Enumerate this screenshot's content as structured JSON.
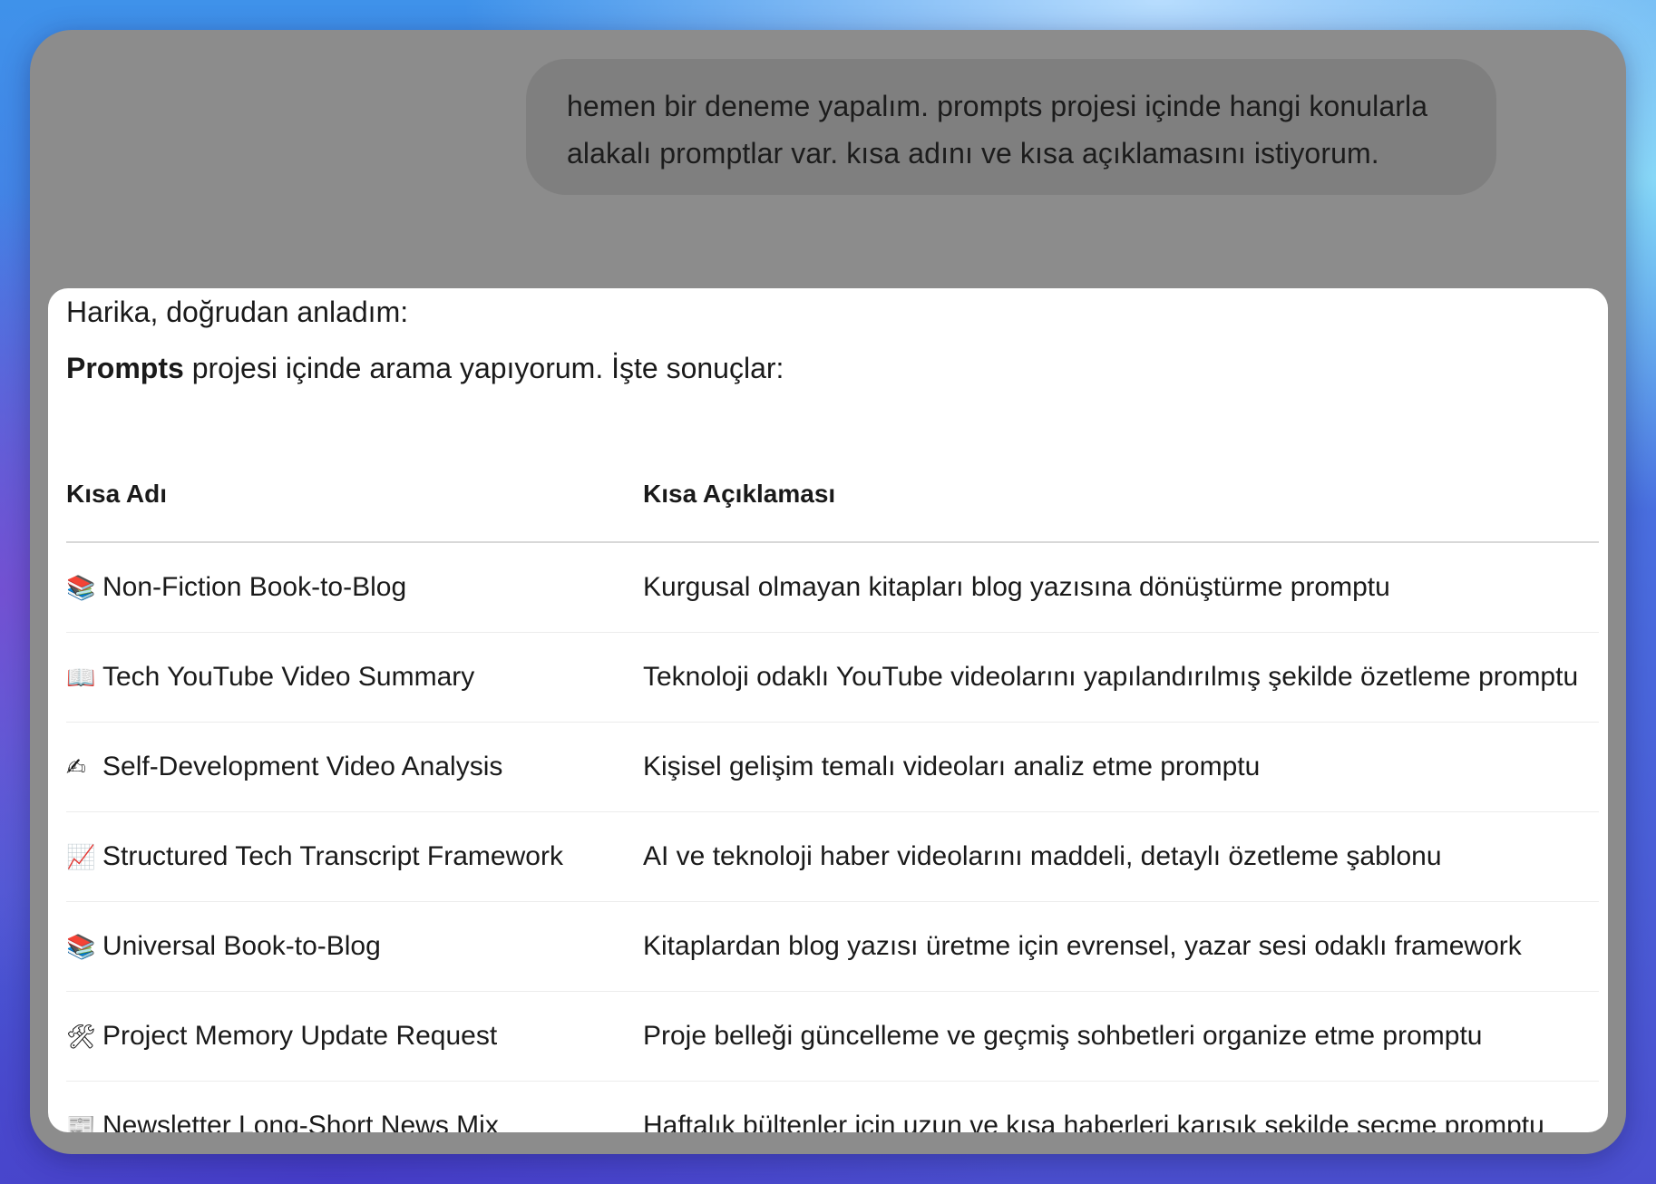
{
  "user_message": {
    "line1": "hemen bir deneme yapalım. prompts projesi içinde hangi konularla",
    "line2": "alakalı promptlar var. kısa adını ve kısa açıklamasını istiyorum."
  },
  "assistant": {
    "greeting": "Harika, doğrudan anladım:",
    "intro_bold": "Prompts",
    "intro_rest": " projesi içinde arama yapıyorum. İşte sonuçlar:",
    "table": {
      "headers": [
        "Kısa Adı",
        "Kısa Açıklaması"
      ],
      "rows": [
        {
          "icon": "📚",
          "icon_name": "books-icon",
          "name": "Non-Fiction Book-to-Blog",
          "desc": "Kurgusal olmayan kitapları blog yazısına dönüştürme promptu"
        },
        {
          "icon": "📖",
          "icon_name": "open-book-icon",
          "name": "Tech YouTube Video Summary",
          "desc": "Teknoloji odaklı YouTube videolarını yapılandırılmış şekilde özetleme promptu"
        },
        {
          "icon": "✍",
          "icon_name": "writing-hand-icon",
          "name": "Self-Development Video Analysis",
          "desc": "Kişisel gelişim temalı videoları analiz etme promptu"
        },
        {
          "icon": "📈",
          "icon_name": "chart-increasing-icon",
          "name": "Structured Tech Transcript Framework",
          "desc": "AI ve teknoloji haber videolarını maddeli, detaylı özetleme şablonu"
        },
        {
          "icon": "📚",
          "icon_name": "books-icon",
          "name": "Universal Book-to-Blog",
          "desc": "Kitaplardan blog yazısı üretme için evrensel, yazar sesi odaklı framework"
        },
        {
          "icon": "🛠",
          "icon_name": "tools-icon",
          "name": "Project Memory Update Request",
          "desc": "Proje belleği güncelleme ve geçmiş sohbetleri organize etme promptu"
        },
        {
          "icon": "📰",
          "icon_name": "newspaper-icon",
          "name": "Newsletter Long-Short News Mix",
          "desc": "Haftalık bültenler için uzun ve kısa haberleri karışık şekilde seçme promptu"
        }
      ]
    }
  }
}
